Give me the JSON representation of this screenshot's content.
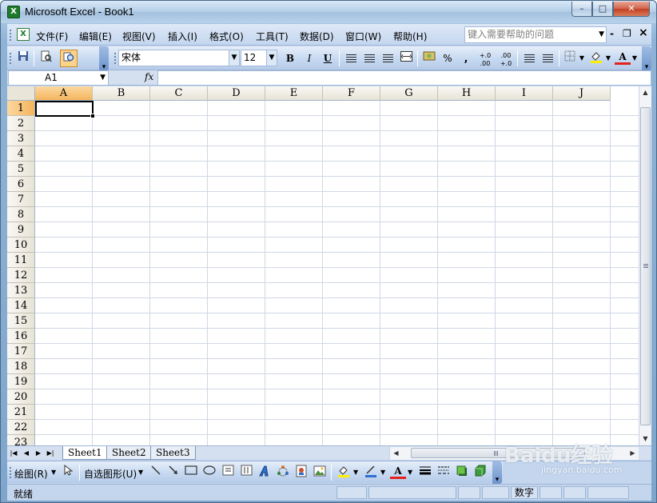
{
  "window": {
    "title": "Microsoft Excel - Book1",
    "app_icon": "X",
    "controls": {
      "minimize": "–",
      "maximize": "□",
      "close": "✕"
    }
  },
  "menubar": {
    "doc_icon": "X",
    "items": [
      "文件(F)",
      "编辑(E)",
      "视图(V)",
      "插入(I)",
      "格式(O)",
      "工具(T)",
      "数据(D)",
      "窗口(W)",
      "帮助(H)"
    ],
    "help_placeholder": "键入需要帮助的问题",
    "doc_controls": {
      "minimize": "-",
      "restore": "❐",
      "close": "×"
    }
  },
  "toolbar": {
    "font_name": "宋体",
    "font_size": "12",
    "bold": "B",
    "italic": "I",
    "underline": "U",
    "percent": "%",
    "comma": ",",
    "inc_decimal": "+.0 .00",
    "dec_decimal": ".00 +.0",
    "font_color_letter": "A",
    "icons": [
      "save-icon",
      "print-preview-icon",
      "research-icon",
      "align-left-icon",
      "align-center-icon",
      "align-right-icon",
      "merge-center-icon",
      "currency-icon",
      "decrease-indent-icon",
      "increase-indent-icon",
      "borders-icon",
      "fill-color-icon",
      "font-color-icon"
    ]
  },
  "formula_bar": {
    "name_box": "A1",
    "fx_label": "fx",
    "formula": ""
  },
  "grid": {
    "columns": [
      "A",
      "B",
      "C",
      "D",
      "E",
      "F",
      "G",
      "H",
      "I",
      "J"
    ],
    "rows": [
      "1",
      "2",
      "3",
      "4",
      "5",
      "6",
      "7",
      "8",
      "9",
      "10",
      "11",
      "12",
      "13",
      "14",
      "15",
      "16",
      "17",
      "18",
      "19",
      "20",
      "21",
      "22",
      "23"
    ],
    "active_cell": "A1"
  },
  "sheets": {
    "tabs": [
      "Sheet1",
      "Sheet2",
      "Sheet3"
    ],
    "active": "Sheet1"
  },
  "drawing_toolbar": {
    "draw_label": "绘图(R)",
    "autoshapes_label": "自选图形(U)",
    "font_color_letter": "A"
  },
  "statusbar": {
    "status": "就绪",
    "mode": "数字"
  },
  "watermark": {
    "brand": "Baidu经验",
    "url": "jingyan.baidu.com"
  },
  "colors": {
    "active_header": "#f5b45c",
    "gridline": "#d0d7e5",
    "chrome": "#c4d6ee",
    "font_color_bar": "#e3221b",
    "fill_color_bar": "#ffee00"
  }
}
